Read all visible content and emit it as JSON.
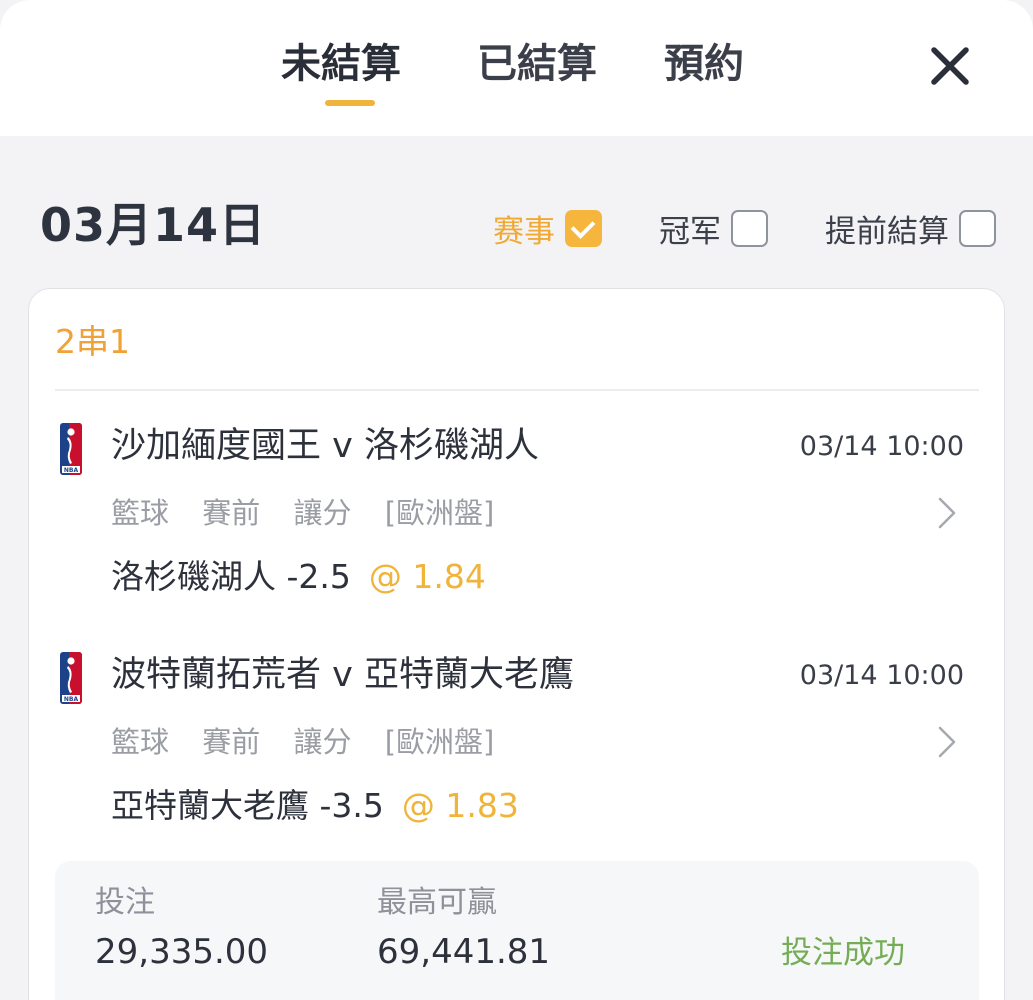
{
  "tabs": {
    "unsettled": "未結算",
    "settled": "已結算",
    "reserved": "預約"
  },
  "date": "03月14日",
  "filters": {
    "match": {
      "label": "赛事",
      "checked": true
    },
    "champion": {
      "label": "冠军",
      "checked": false
    },
    "early_settle": {
      "label": "提前結算",
      "checked": false
    }
  },
  "bet": {
    "type": "2串1",
    "legs": [
      {
        "title": "沙加緬度國王 v 洛杉磯湖人",
        "time": "03/14 10:00",
        "sport": "籃球",
        "stage": "賽前",
        "bet_type": "讓分",
        "odds_format": "[歐洲盤]",
        "pick": "洛杉磯湖人 -2.5",
        "odds": "@ 1.84"
      },
      {
        "title": "波特蘭拓荒者 v 亞特蘭大老鷹",
        "time": "03/14 10:00",
        "sport": "籃球",
        "stage": "賽前",
        "bet_type": "讓分",
        "odds_format": "[歐洲盤]",
        "pick": "亞特蘭大老鷹 -3.5",
        "odds": "@ 1.83"
      }
    ],
    "stake_label": "投注",
    "stake_value": "29,335.00",
    "max_win_label": "最高可贏",
    "max_win_value": "69,441.81",
    "status": "投注成功"
  },
  "icons": {
    "close": "close-icon",
    "league": "nba-logo-icon",
    "chevron": "chevron-right-icon",
    "check": "check-icon"
  },
  "colors": {
    "accent": "#f0b43a",
    "parlay": "#f0a138",
    "success": "#74ad55",
    "muted": "#9a9da4"
  }
}
